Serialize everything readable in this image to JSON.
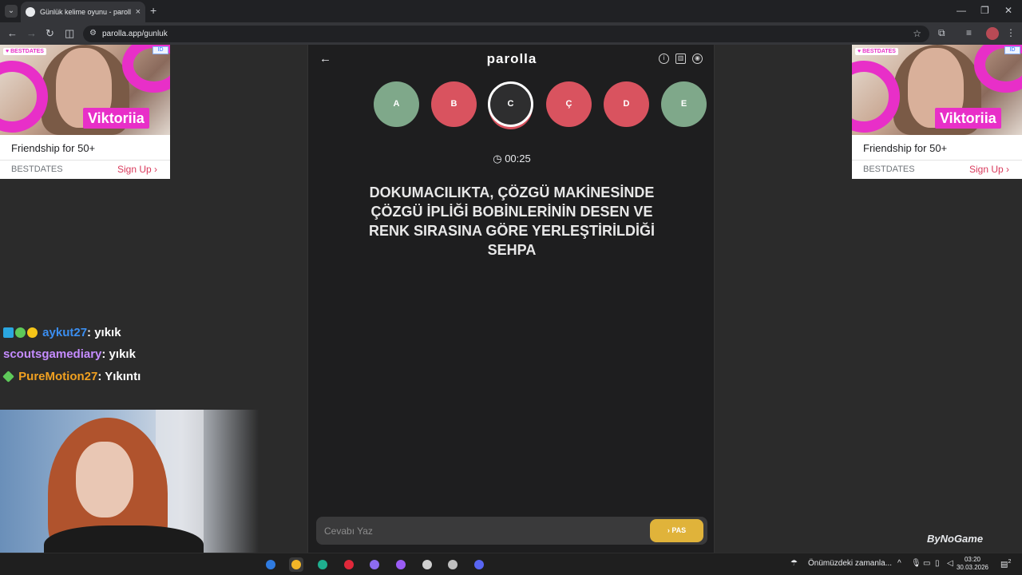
{
  "browser": {
    "tab_title": "Günlük kelime oyunu - parolla",
    "tab_close": "×",
    "new_tab": "+",
    "url": "parolla.app/gunluk",
    "window_controls": [
      "—",
      "❐",
      "✕"
    ]
  },
  "ads": {
    "left": {
      "brand_tag": "♥ BESTDATES",
      "name": "Viktoriia",
      "headline": "Friendship for 50+",
      "brand": "BESTDATES",
      "cta": "Sign Up ›",
      "adchoices": "ID"
    },
    "right": {
      "brand_tag": "♥ BESTDATES",
      "name": "Viktoriia",
      "headline": "Friendship for 50+",
      "brand": "BESTDATES",
      "cta": "Sign Up ›",
      "adchoices": "ID"
    }
  },
  "chat": [
    {
      "user": "aykut27",
      "message": ": yıkık",
      "color": "#3b8ef0"
    },
    {
      "user": "scoutsgamediary",
      "message": ": yıkık",
      "color": "#c58cff"
    },
    {
      "user": "PureMotion27",
      "message": ": Yıkıntı",
      "color": "#f0a020"
    }
  ],
  "game": {
    "logo": "parolla",
    "back_icon": "←",
    "letters": [
      {
        "letter": "A",
        "state": "correct"
      },
      {
        "letter": "B",
        "state": "wrong"
      },
      {
        "letter": "C",
        "state": "active"
      },
      {
        "letter": "Ç",
        "state": "wrong"
      },
      {
        "letter": "D",
        "state": "wrong"
      },
      {
        "letter": "E",
        "state": "correct"
      }
    ],
    "timer": "00:25",
    "question": "DOKUMACILIKTA, ÇÖZGÜ MAKİNESİNDE ÇÖZGÜ İPLİĞİ BOBİNLERİNİN DESEN VE RENK SIRASINA GÖRE YERLEŞTİRİLDİĞİ SEHPA",
    "answer_placeholder": "Cevabı Yaz",
    "pass_label": "› PAS",
    "colors": {
      "correct": "#7fa88a",
      "wrong": "#d9535f",
      "pass": "#e0b33a"
    }
  },
  "watermark": "ByNoGame",
  "taskbar": {
    "weather_text": "Önümüzdeki zamanla...",
    "time": "03:20",
    "date": "30.03.2026",
    "notification_count": "2"
  }
}
